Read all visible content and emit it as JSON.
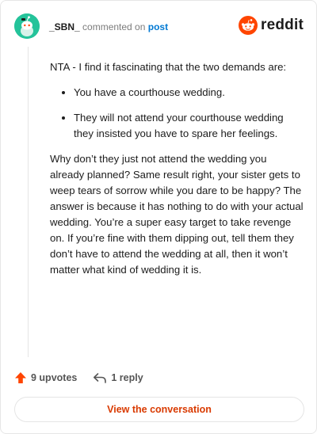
{
  "header": {
    "username": "_SBN_",
    "action_text": "commented on",
    "post_link": "post",
    "logo_text": "reddit"
  },
  "comment": {
    "intro": "NTA - I find it fascinating that the two demands are:",
    "bullets": [
      "You have a courthouse wedding.",
      "They will not attend your courthouse wedding they insisted you have to spare her feelings."
    ],
    "paragraph": "Why don’t they just not attend the wedding you already planned? Same result right, your sister gets to weep tears of sorrow while you dare to be happy? The answer is because it has nothing to do with your actual wedding. You’re a super easy target to take revenge on. If you’re fine with them dipping out, tell them they don’t have to attend the wedding at all, then it won’t matter what kind of wedding it is."
  },
  "actions": {
    "upvotes": "9 upvotes",
    "replies": "1 reply"
  },
  "cta": {
    "label": "View the conversation"
  },
  "colors": {
    "upvote": "#ff4500",
    "link": "#0079d3",
    "cta": "#d93a00",
    "avatar_bg": "#24c39a"
  }
}
